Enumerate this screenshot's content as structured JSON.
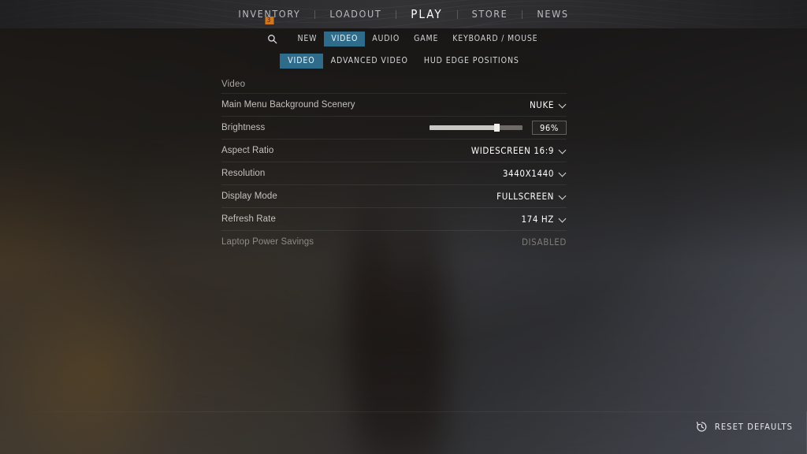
{
  "topnav": {
    "items": [
      {
        "label": "INVENTORY",
        "active": false,
        "badge": "3"
      },
      {
        "label": "LOADOUT",
        "active": false,
        "badge": null
      },
      {
        "label": "PLAY",
        "active": true,
        "badge": null
      },
      {
        "label": "STORE",
        "active": false,
        "badge": null
      },
      {
        "label": "NEWS",
        "active": false,
        "badge": null
      }
    ]
  },
  "subnav": {
    "search_icon": "search-icon",
    "primary_tabs": [
      {
        "label": "NEW",
        "active": false
      },
      {
        "label": "VIDEO",
        "active": true
      },
      {
        "label": "AUDIO",
        "active": false
      },
      {
        "label": "GAME",
        "active": false
      },
      {
        "label": "KEYBOARD / MOUSE",
        "active": false
      }
    ],
    "secondary_tabs": [
      {
        "label": "VIDEO",
        "active": true
      },
      {
        "label": "ADVANCED VIDEO",
        "active": false
      },
      {
        "label": "HUD EDGE POSITIONS",
        "active": false
      }
    ]
  },
  "settings": {
    "section_title": "Video",
    "rows": [
      {
        "label": "Main Menu Background Scenery",
        "type": "dropdown",
        "value": "NUKE",
        "disabled": false
      },
      {
        "label": "Brightness",
        "type": "slider",
        "value": "96%",
        "fill_percent": 72,
        "disabled": false
      },
      {
        "label": "Aspect Ratio",
        "type": "dropdown",
        "value": "WIDESCREEN 16:9",
        "disabled": false
      },
      {
        "label": "Resolution",
        "type": "dropdown",
        "value": "3440X1440",
        "disabled": false
      },
      {
        "label": "Display Mode",
        "type": "dropdown",
        "value": "FULLSCREEN",
        "disabled": false
      },
      {
        "label": "Refresh Rate",
        "type": "dropdown",
        "value": "174 HZ",
        "disabled": false
      },
      {
        "label": "Laptop Power Savings",
        "type": "static",
        "value": "DISABLED",
        "disabled": true
      }
    ]
  },
  "footer": {
    "reset_label": "RESET DEFAULTS",
    "reset_icon": "history-clock-icon"
  },
  "colors": {
    "accent_tab": "#2f6c8b",
    "badge_orange": "#d2761d",
    "topbar_bg": "#2b2b2d",
    "text_primary": "#ffffff",
    "text_muted": "#8e8b87"
  }
}
